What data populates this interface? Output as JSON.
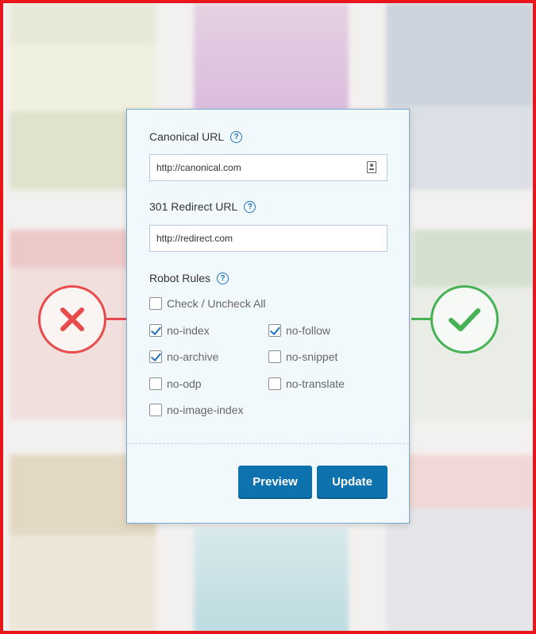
{
  "canonical": {
    "label": "Canonical URL",
    "value": "http://canonical.com",
    "help_icon": "question-circle-icon",
    "field_icon": "contact-card-icon"
  },
  "redirect": {
    "label": "301 Redirect URL",
    "value": "http://redirect.com",
    "help_icon": "question-circle-icon"
  },
  "robots": {
    "label": "Robot Rules",
    "help_icon": "question-circle-icon",
    "check_all": {
      "label": "Check / Uncheck All",
      "checked": false
    },
    "rules": [
      {
        "label": "no-index",
        "checked": true
      },
      {
        "label": "no-follow",
        "checked": true
      },
      {
        "label": "no-archive",
        "checked": true
      },
      {
        "label": "no-snippet",
        "checked": false
      },
      {
        "label": "no-odp",
        "checked": false
      },
      {
        "label": "no-translate",
        "checked": false
      },
      {
        "label": "no-image-index",
        "checked": false
      }
    ]
  },
  "buttons": {
    "preview_label": "Preview",
    "update_label": "Update"
  },
  "help_glyph": "?",
  "decor": {
    "fail_icon": "x-icon",
    "success_icon": "checkmark-icon",
    "fail_color": "#e94a4a",
    "success_color": "#47b253",
    "accent_color": "#0d72ae",
    "frame_color": "#e8161b"
  }
}
